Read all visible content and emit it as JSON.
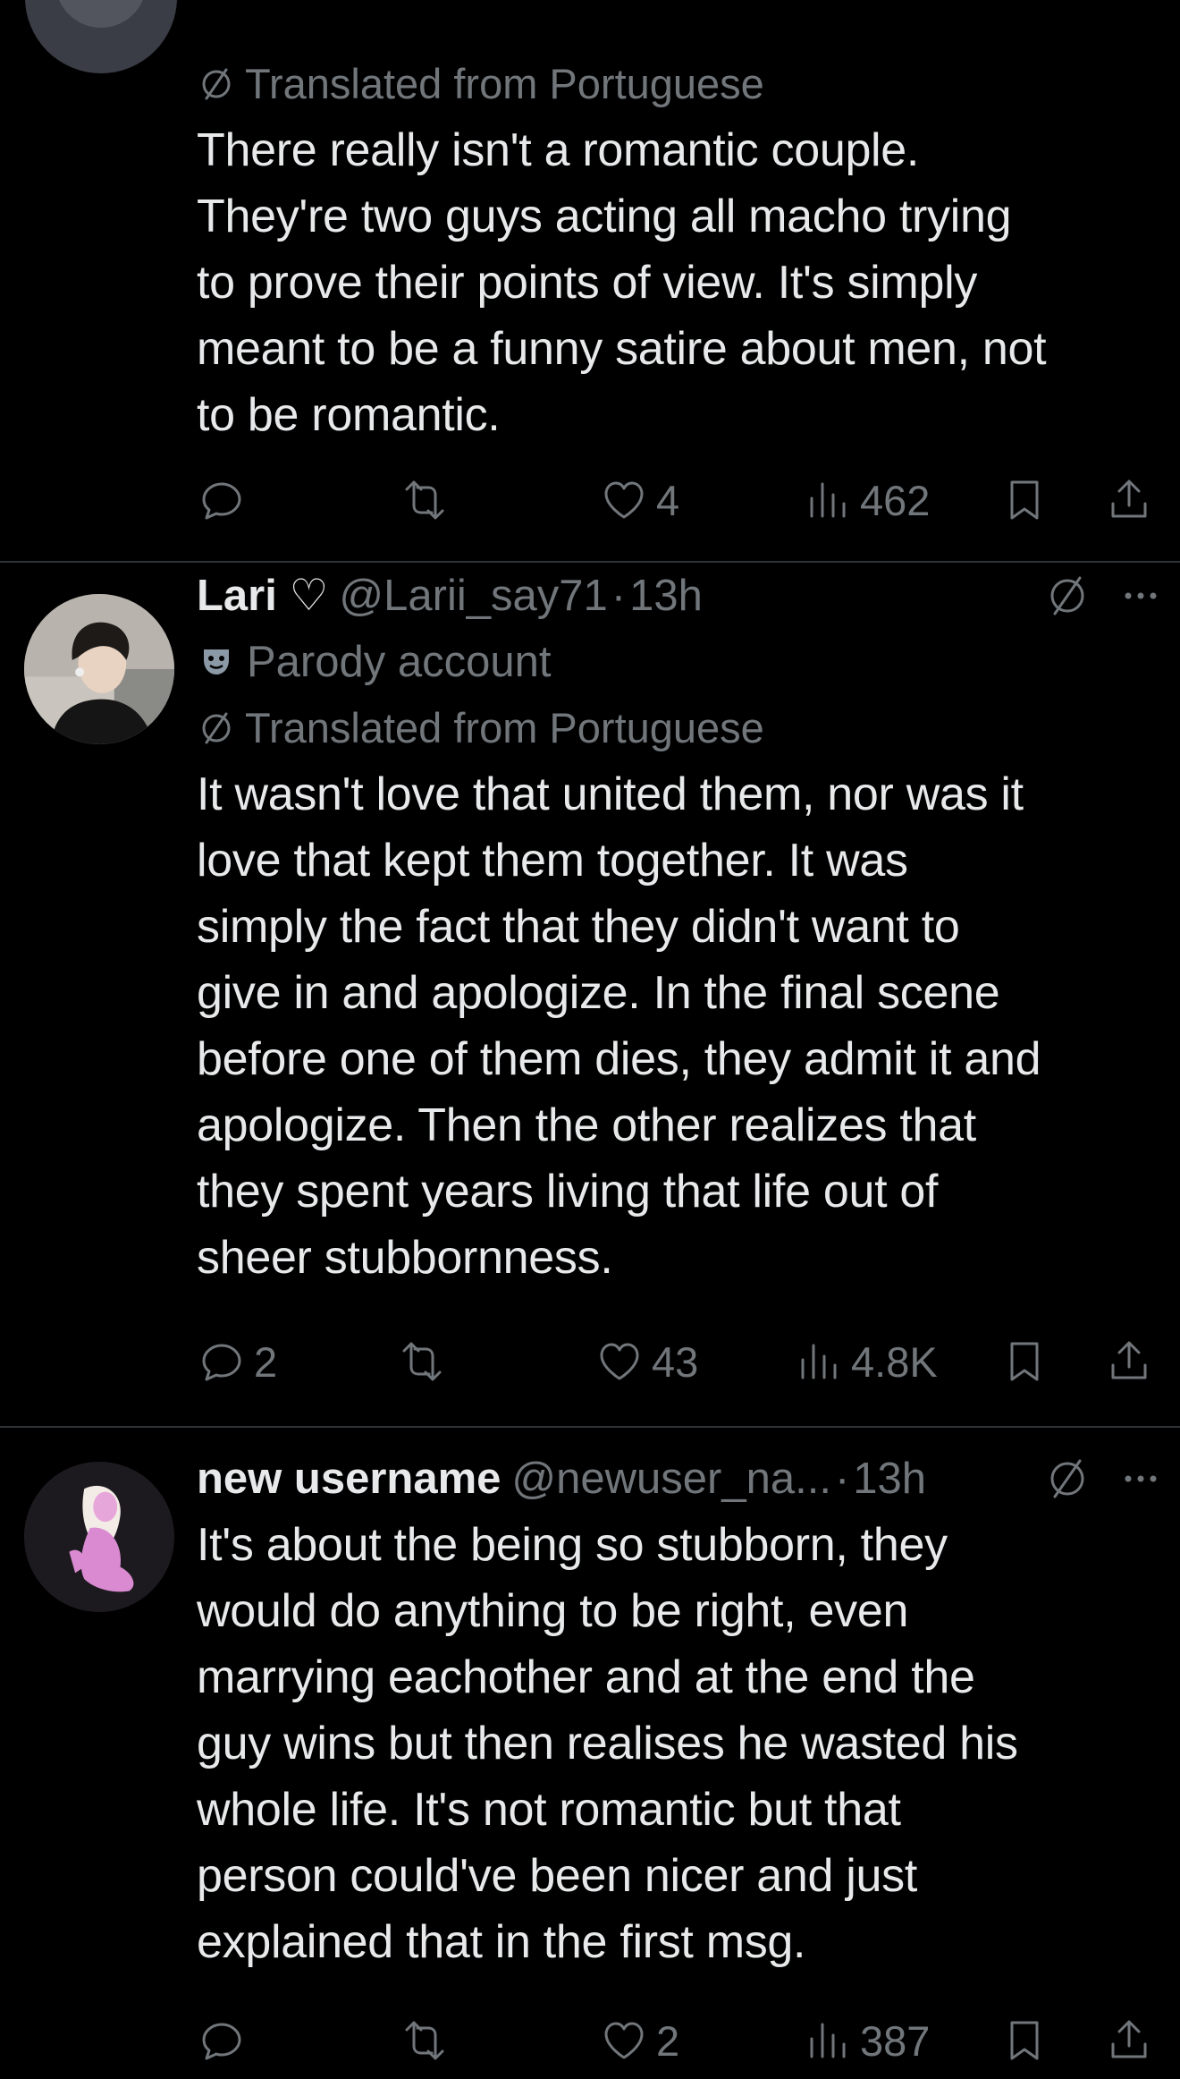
{
  "posts": [
    {
      "translated_label": "Translated from Portuguese",
      "text": "There really isn't a romantic couple.\nThey're two guys acting all macho trying\nto prove their points of view. It's simply\nmeant to be a funny satire about men, not\nto be romantic.",
      "replies": "",
      "likes": "4",
      "views": "462"
    },
    {
      "name": "Lari ♡",
      "handle": "@Larii_say71",
      "separator": "·",
      "time": "13h",
      "badge_label": "Parody account",
      "translated_label": "Translated from Portuguese",
      "text": "It wasn't love that united them, nor was it\nlove that kept them together. It was\nsimply the fact that they didn't want to\ngive in and apologize. In the final scene\nbefore one of them dies, they admit it and\napologize. Then the other realizes that\nthey spent years living that life out of\nsheer stubbornness.",
      "replies": "2",
      "likes": "43",
      "views": "4.8K"
    },
    {
      "name": "new username",
      "handle": "@newuser_na...",
      "separator": "·",
      "time": "13h",
      "text": "It's about the being so stubborn, they\nwould do anything to be right, even\nmarrying eachother and at the end the\nguy wins but then realises he wasted his\nwhole life. It's not romantic but that\nperson could've been nicer and just\nexplained that in the first msg.",
      "replies": "",
      "likes": "2",
      "views": "387"
    }
  ],
  "icons": {
    "reply": "reply-icon",
    "repost": "repost-icon",
    "like": "heart-icon",
    "views": "views-icon",
    "bookmark": "bookmark-icon",
    "share": "share-icon",
    "translate": "translate-icon",
    "more": "more-icon",
    "parody": "parody-mask-icon"
  },
  "colors": {
    "background": "#000000",
    "text": "#e7e9ea",
    "secondary": "#71767b",
    "divider": "#2f3336"
  }
}
